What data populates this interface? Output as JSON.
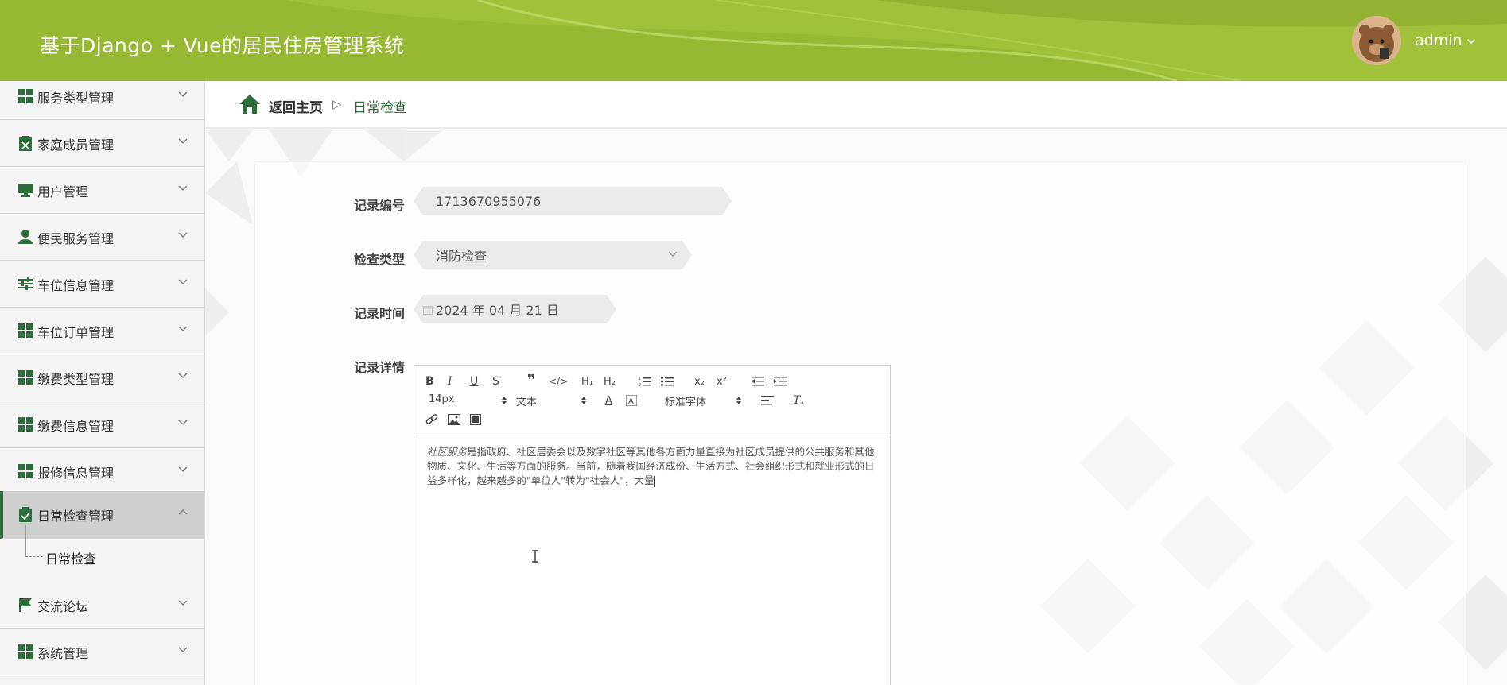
{
  "header": {
    "title": "基于Django + Vue的居民住房管理系统",
    "username": "admin"
  },
  "sidebar": {
    "items": [
      {
        "label": "服务类型管理",
        "icon": "grid-icon"
      },
      {
        "label": "家庭成员管理",
        "icon": "clipboard-x-icon"
      },
      {
        "label": "用户管理",
        "icon": "monitor-icon"
      },
      {
        "label": "便民服务管理",
        "icon": "user-icon"
      },
      {
        "label": "车位信息管理",
        "icon": "sliders-icon"
      },
      {
        "label": "车位订单管理",
        "icon": "grid-icon"
      },
      {
        "label": "缴费类型管理",
        "icon": "grid-icon"
      },
      {
        "label": "缴费信息管理",
        "icon": "grid-icon"
      },
      {
        "label": "报修信息管理",
        "icon": "grid-icon"
      },
      {
        "label": "日常检查管理",
        "icon": "clipboard-check-icon"
      },
      {
        "label": "交流论坛",
        "icon": "flag-icon"
      },
      {
        "label": "系统管理",
        "icon": "grid-icon"
      }
    ],
    "active_index": 9,
    "submenu_label": "日常检查"
  },
  "breadcrumb": {
    "home": "返回主页",
    "separator": "▷",
    "current": "日常检查"
  },
  "form": {
    "record_no_label": "记录编号",
    "record_no_value": "1713670955076",
    "check_type_label": "检查类型",
    "check_type_value": "消防检查",
    "record_time_label": "记录时间",
    "record_time_value": "2024 年 04 月 21 日",
    "detail_label": "记录详情"
  },
  "editor": {
    "font_size": "14px",
    "paragraph": "文本",
    "font_family": "标准字体",
    "content_em": "社区服务",
    "content": "是指政府、社区居委会以及数字社区等其他各方面力量直接为社区成员提供的公共服务和其他物质、文化、生活等方面的服务。当前，随着我国经济成份、生活方式、社会组织形式和就业形式的日益多样化，越来越多的\"单位人\"转为\"社会人\"，大量"
  },
  "colors": {
    "header": "#97b833",
    "accent": "#2d6d3c",
    "sidebar_bg": "#f4f4f4",
    "active_bg": "#cfcfcf"
  }
}
